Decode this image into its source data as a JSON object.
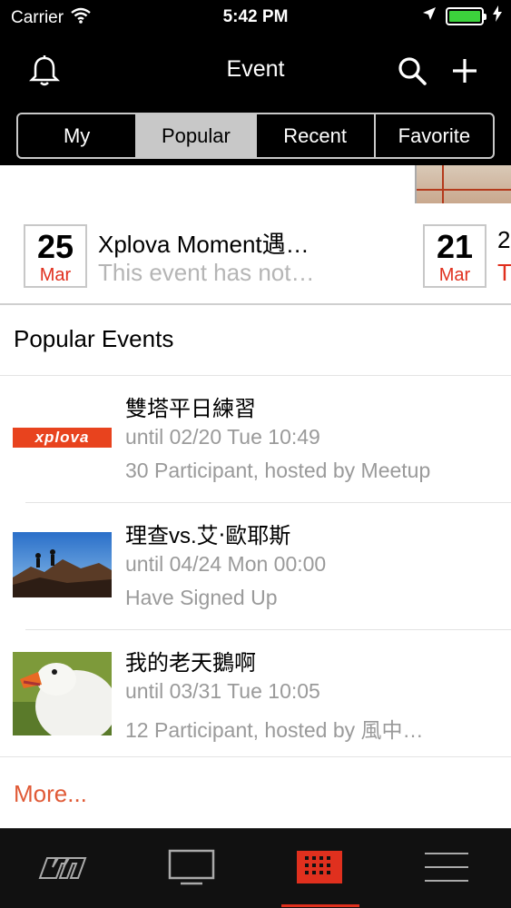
{
  "status_bar": {
    "carrier": "Carrier",
    "time": "5:42 PM",
    "battery_color": "#3cd23c"
  },
  "nav": {
    "title": "Event",
    "icons": [
      "bell-icon",
      "search-icon",
      "plus-icon"
    ]
  },
  "segments": [
    {
      "label": "My",
      "active": false
    },
    {
      "label": "Popular",
      "active": true
    },
    {
      "label": "Recent",
      "active": false
    },
    {
      "label": "Favorite",
      "active": false
    }
  ],
  "featured": [
    {
      "day": "25",
      "month": "Mar",
      "title": "Xplova Moment遇…",
      "subtitle": "This event has not…"
    },
    {
      "day": "21",
      "month": "Mar",
      "title": "2",
      "subtitle": "T"
    }
  ],
  "popular": {
    "header": "Popular Events",
    "events": [
      {
        "title": "雙塔平日練習",
        "date": "until 02/20 Tue 10:49",
        "meta": "30 Participant, hosted by Meetup",
        "image": "xplova-logo"
      },
      {
        "title": "理查vs.艾‧歐耶斯",
        "date": "until 04/24 Mon 00:00",
        "meta": "Have Signed Up",
        "image": "hikers-photo"
      },
      {
        "title": "我的老天鵝啊",
        "date": "until 03/31 Tue 10:05",
        "meta": "12 Participant, hosted by 風中…",
        "image": "goose-photo"
      }
    ],
    "more_label": "More..."
  },
  "xplova_logo_text": "xplova",
  "tab_bar": {
    "tabs": [
      "xplova-m-icon",
      "monitor-icon",
      "calendar-grid-icon",
      "menu-icon"
    ],
    "active_index": 2,
    "accent_color": "#e0301e"
  }
}
